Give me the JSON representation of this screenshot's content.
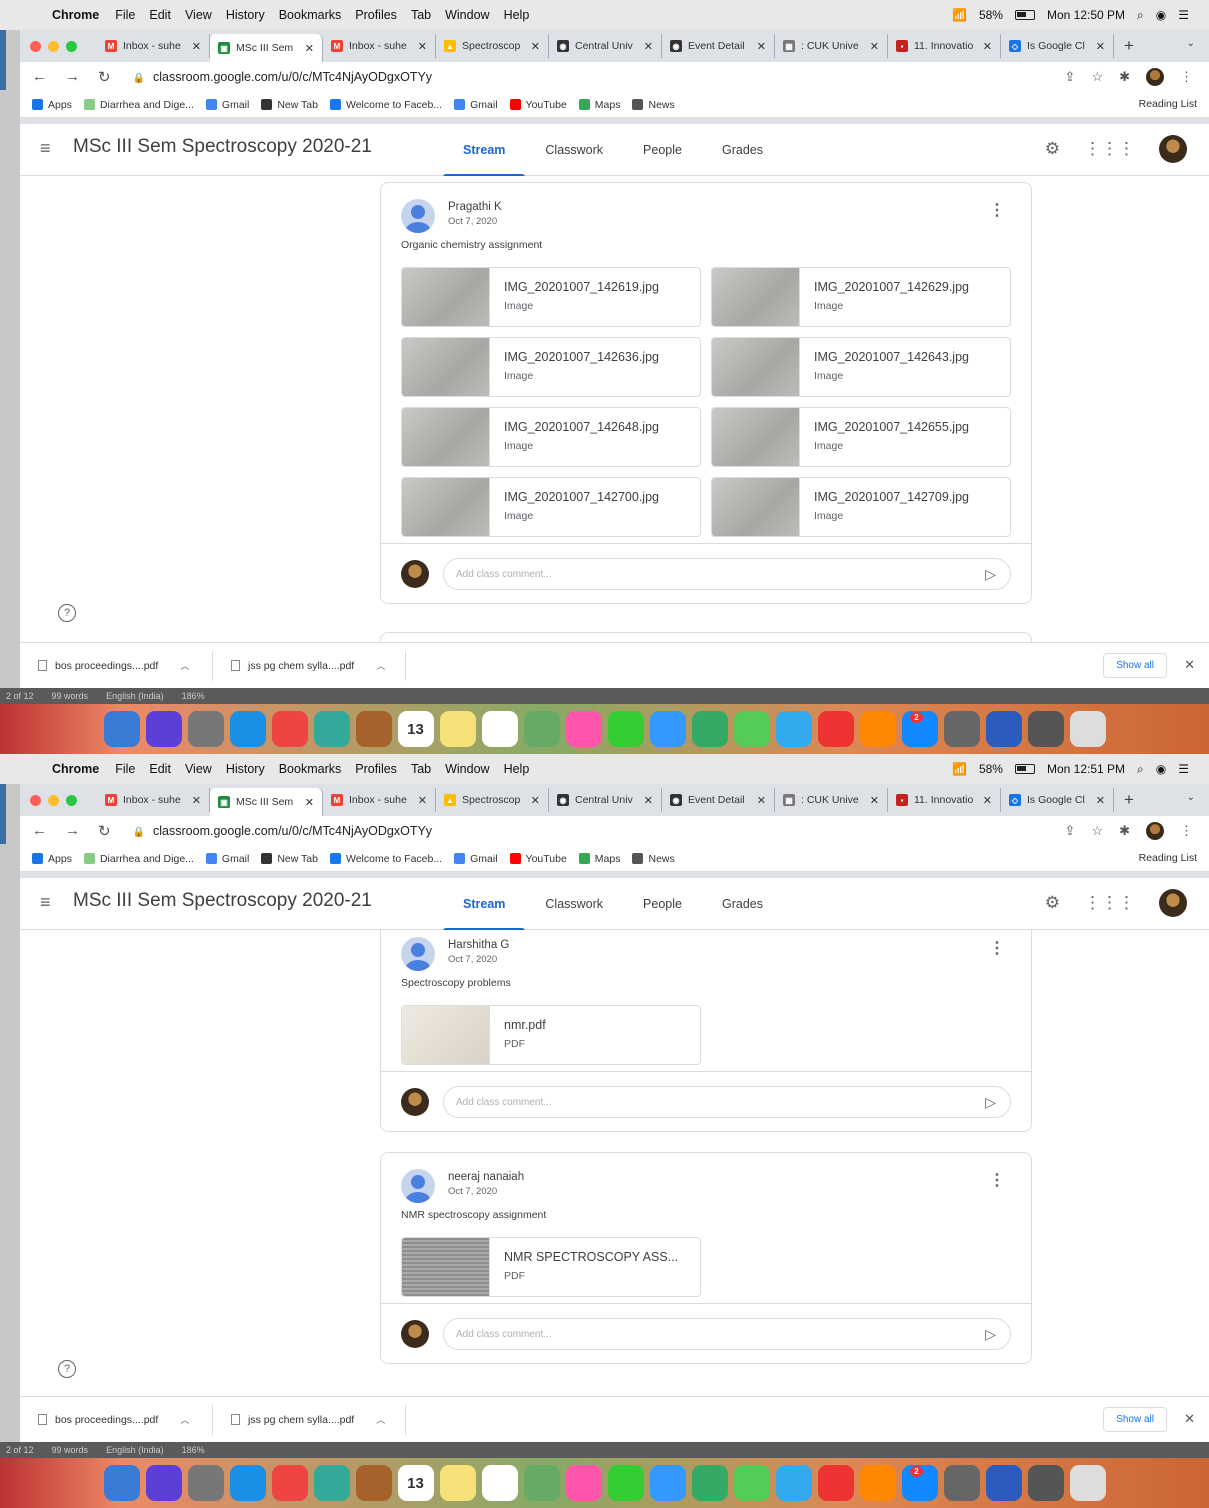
{
  "screens": [
    {
      "menubar": {
        "app": "Chrome",
        "items": [
          "File",
          "Edit",
          "View",
          "History",
          "Bookmarks",
          "Profiles",
          "Tab",
          "Window",
          "Help"
        ],
        "battery": "58%",
        "time": "Mon 12:50 PM"
      },
      "tabs": [
        {
          "label": "Inbox - suhe",
          "color": "#ea4335",
          "glyph": "M"
        },
        {
          "label": "MSc III Sem",
          "color": "#1e8e3e",
          "glyph": "▣",
          "active": true
        },
        {
          "label": "Inbox - suhe",
          "color": "#ea4335",
          "glyph": "M"
        },
        {
          "label": "Spectroscop",
          "color": "#fbbc04",
          "glyph": "▲"
        },
        {
          "label": "Central Univ",
          "color": "#333333",
          "glyph": "◉"
        },
        {
          "label": "Event Detail",
          "color": "#333333",
          "glyph": "◉"
        },
        {
          "label": ": CUK Unive",
          "color": "#777777",
          "glyph": "▦"
        },
        {
          "label": "11. Innovatio",
          "color": "#c5221f",
          "glyph": "▪"
        },
        {
          "label": "Is Google Cl",
          "color": "#1a73e8",
          "glyph": "◇"
        }
      ],
      "url": "classroom.google.com/u/0/c/MTc4NjAyODgxOTYy",
      "bookmarks": [
        "Apps",
        "Diarrhea and Dige...",
        "Gmail",
        "New Tab",
        "Welcome to Faceb...",
        "Gmail",
        "YouTube",
        "Maps",
        "News"
      ],
      "reading_list": "Reading List",
      "class": {
        "title": "MSc III Sem Spectroscopy 2020-21",
        "tabs": [
          "Stream",
          "Classwork",
          "People",
          "Grades"
        ]
      },
      "posts": [
        {
          "author": "Pragathi K",
          "date": "Oct 7, 2020",
          "text": "Organic chemistry assignment",
          "attachments": [
            {
              "name": "IMG_20201007_142619.jpg",
              "type": "Image"
            },
            {
              "name": "IMG_20201007_142629.jpg",
              "type": "Image"
            },
            {
              "name": "IMG_20201007_142636.jpg",
              "type": "Image"
            },
            {
              "name": "IMG_20201007_142643.jpg",
              "type": "Image"
            },
            {
              "name": "IMG_20201007_142648.jpg",
              "type": "Image"
            },
            {
              "name": "IMG_20201007_142655.jpg",
              "type": "Image"
            },
            {
              "name": "IMG_20201007_142700.jpg",
              "type": "Image"
            },
            {
              "name": "IMG_20201007_142709.jpg",
              "type": "Image"
            }
          ],
          "comment_placeholder": "Add class comment..."
        }
      ],
      "downloads": [
        "bos proceedings....pdf",
        "jss pg chem sylla....pdf"
      ],
      "show_all": "Show all",
      "wordbar": [
        "2 of 12",
        "99 words",
        "English (India)",
        "186%"
      ]
    },
    {
      "menubar": {
        "app": "Chrome",
        "items": [
          "File",
          "Edit",
          "View",
          "History",
          "Bookmarks",
          "Profiles",
          "Tab",
          "Window",
          "Help"
        ],
        "battery": "58%",
        "time": "Mon 12:51 PM"
      },
      "tabs": [
        {
          "label": "Inbox - suhe",
          "color": "#ea4335",
          "glyph": "M"
        },
        {
          "label": "MSc III Sem",
          "color": "#1e8e3e",
          "glyph": "▣",
          "active": true
        },
        {
          "label": "Inbox - suhe",
          "color": "#ea4335",
          "glyph": "M"
        },
        {
          "label": "Spectroscop",
          "color": "#fbbc04",
          "glyph": "▲"
        },
        {
          "label": "Central Univ",
          "color": "#333333",
          "glyph": "◉"
        },
        {
          "label": "Event Detail",
          "color": "#333333",
          "glyph": "◉"
        },
        {
          "label": ": CUK Unive",
          "color": "#777777",
          "glyph": "▦"
        },
        {
          "label": "11. Innovatio",
          "color": "#c5221f",
          "glyph": "▪"
        },
        {
          "label": "Is Google Cl",
          "color": "#1a73e8",
          "glyph": "◇"
        }
      ],
      "url": "classroom.google.com/u/0/c/MTc4NjAyODgxOTYy",
      "bookmarks": [
        "Apps",
        "Diarrhea and Dige...",
        "Gmail",
        "New Tab",
        "Welcome to Faceb...",
        "Gmail",
        "YouTube",
        "Maps",
        "News"
      ],
      "reading_list": "Reading List",
      "class": {
        "title": "MSc III Sem Spectroscopy 2020-21",
        "tabs": [
          "Stream",
          "Classwork",
          "People",
          "Grades"
        ]
      },
      "posts": [
        {
          "author": "Harshitha G",
          "date": "Oct 7, 2020",
          "text": "Spectroscopy problems",
          "attachments": [
            {
              "name": "nmr.pdf",
              "type": "PDF"
            }
          ],
          "comment_placeholder": "Add class comment..."
        },
        {
          "author": "neeraj nanaiah",
          "date": "Oct 7, 2020",
          "text": "NMR spectroscopy assignment",
          "attachments": [
            {
              "name": "NMR SPECTROSCOPY ASS...",
              "type": "PDF"
            }
          ],
          "comment_placeholder": "Add class comment..."
        }
      ],
      "downloads": [
        "bos proceedings....pdf",
        "jss pg chem sylla....pdf"
      ],
      "show_all": "Show all",
      "wordbar": [
        "2 of 12",
        "99 words",
        "English (India)",
        "186%"
      ]
    }
  ],
  "dock_icons": [
    "finder-icon",
    "siri-icon",
    "launchpad-icon",
    "safari-icon",
    "chrome-icon",
    "preview-icon",
    "notes-book-icon",
    "calendar-icon",
    "notes-icon",
    "reminders-icon",
    "photos-app-icon",
    "photos-icon",
    "facetime-icon",
    "messages-icon",
    "textedit-icon",
    "numbers-icon",
    "keynote-icon",
    "itunes-icon",
    "books-icon",
    "app-store-icon",
    "system-preferences-icon",
    "word-icon",
    "preview-photo-icon",
    "trash-icon"
  ],
  "calendar_day": "13",
  "app_store_badge": "2"
}
